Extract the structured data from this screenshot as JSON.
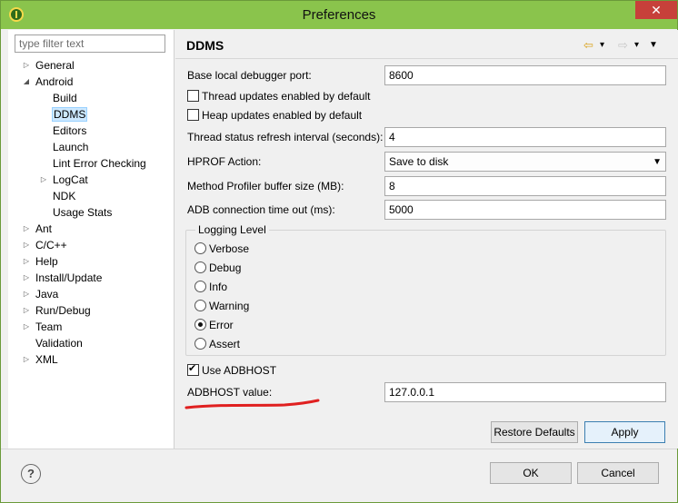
{
  "window": {
    "title": "Preferences",
    "close_label": "✕"
  },
  "filter": {
    "placeholder": "type filter text"
  },
  "tree": {
    "items": [
      {
        "label": "General",
        "arrow": "▷",
        "indent": 0
      },
      {
        "label": "Android",
        "arrow": "◢",
        "indent": 0
      },
      {
        "label": "Build",
        "arrow": "",
        "indent": 1
      },
      {
        "label": "DDMS",
        "arrow": "",
        "indent": 1,
        "selected": true
      },
      {
        "label": "Editors",
        "arrow": "",
        "indent": 1
      },
      {
        "label": "Launch",
        "arrow": "",
        "indent": 1
      },
      {
        "label": "Lint Error Checking",
        "arrow": "",
        "indent": 1
      },
      {
        "label": "LogCat",
        "arrow": "▷",
        "indent": 1
      },
      {
        "label": "NDK",
        "arrow": "",
        "indent": 1
      },
      {
        "label": "Usage Stats",
        "arrow": "",
        "indent": 1
      },
      {
        "label": "Ant",
        "arrow": "▷",
        "indent": 0
      },
      {
        "label": "C/C++",
        "arrow": "▷",
        "indent": 0
      },
      {
        "label": "Help",
        "arrow": "▷",
        "indent": 0
      },
      {
        "label": "Install/Update",
        "arrow": "▷",
        "indent": 0
      },
      {
        "label": "Java",
        "arrow": "▷",
        "indent": 0
      },
      {
        "label": "Run/Debug",
        "arrow": "▷",
        "indent": 0
      },
      {
        "label": "Team",
        "arrow": "▷",
        "indent": 0
      },
      {
        "label": "Validation",
        "arrow": "",
        "indent": 0
      },
      {
        "label": "XML",
        "arrow": "▷",
        "indent": 0
      }
    ]
  },
  "page": {
    "title": "DDMS",
    "nav": {
      "back": "⇦",
      "forward": "⇨",
      "dropdown": "▾",
      "menu": "▼"
    },
    "fields": {
      "base_port_label": "Base local debugger port:",
      "base_port_value": "8600",
      "thread_updates_label": "Thread updates enabled by default",
      "thread_updates_checked": false,
      "heap_updates_label": "Heap updates enabled by default",
      "heap_updates_checked": false,
      "thread_refresh_label": "Thread status refresh interval (seconds):",
      "thread_refresh_value": "4",
      "hprof_label": "HPROF Action:",
      "hprof_value": "Save to disk",
      "profiler_buffer_label": "Method Profiler buffer size (MB):",
      "profiler_buffer_value": "8",
      "adb_timeout_label": "ADB connection time out (ms):",
      "adb_timeout_value": "5000"
    },
    "logging": {
      "title": "Logging Level",
      "options": [
        "Verbose",
        "Debug",
        "Info",
        "Warning",
        "Error",
        "Assert"
      ],
      "selected": "Error"
    },
    "adbhost": {
      "use_label": "Use ADBHOST",
      "use_checked": true,
      "value_label": "ADBHOST value:",
      "value": "127.0.0.1"
    },
    "buttons": {
      "restore_defaults": "Restore Defaults",
      "apply": "Apply"
    }
  },
  "footer": {
    "help": "?",
    "ok": "OK",
    "cancel": "Cancel"
  },
  "colors": {
    "titlebar": "#8ac44c",
    "close": "#c7403a",
    "selection": "#cce8ff",
    "annotation": "#e02020"
  }
}
